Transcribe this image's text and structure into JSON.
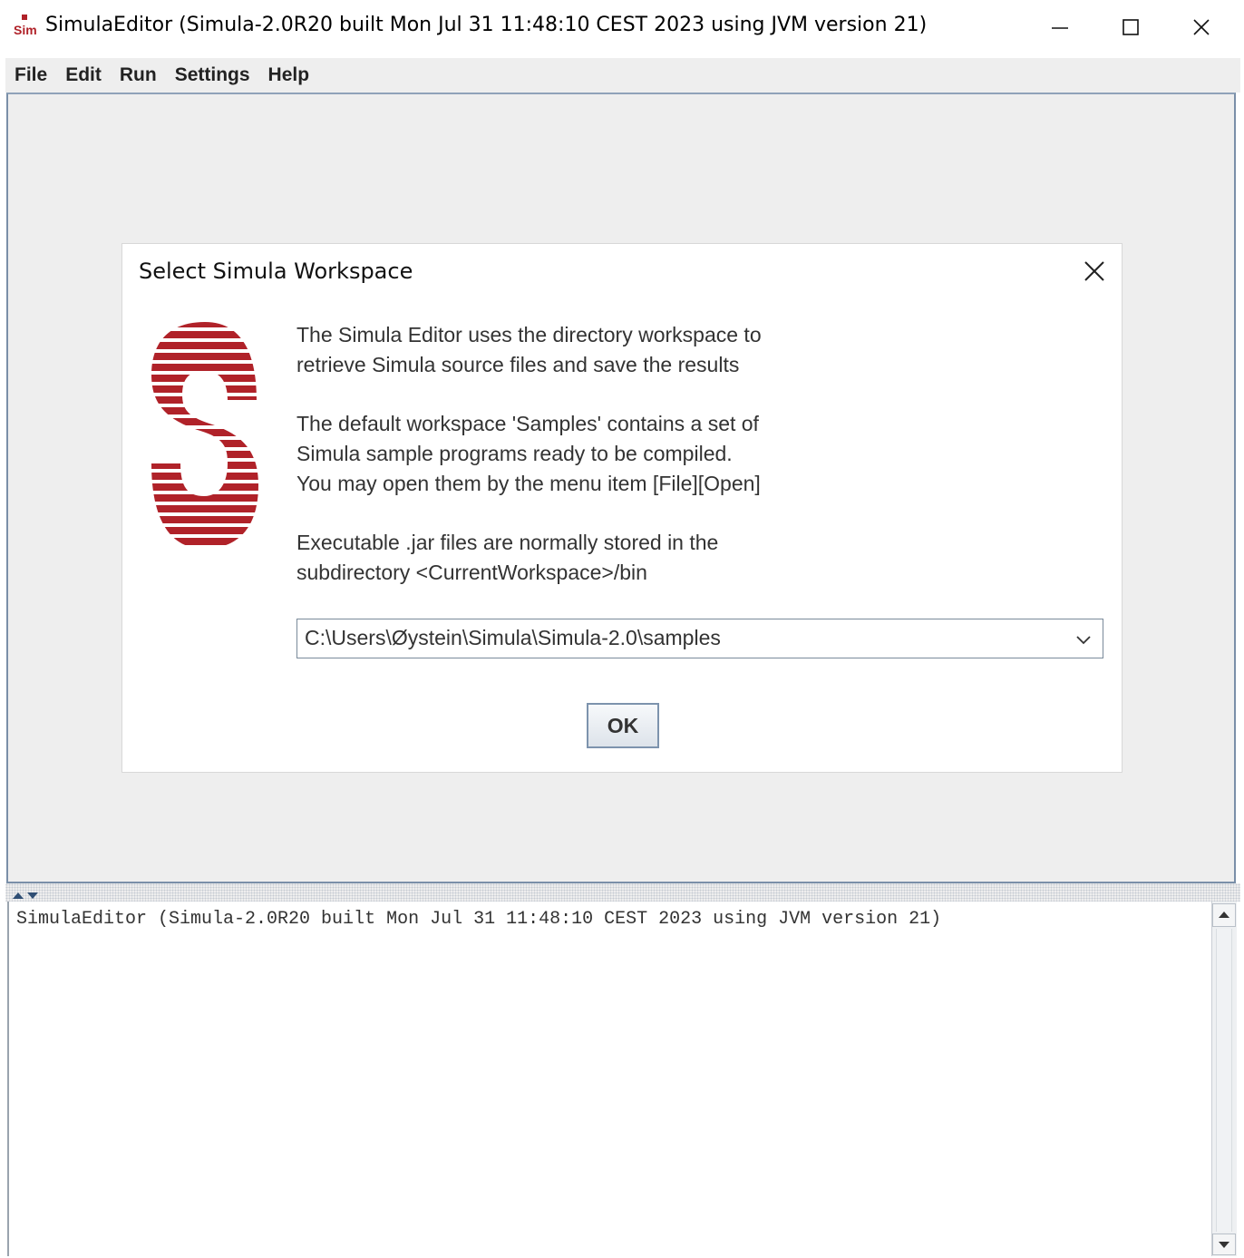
{
  "window": {
    "title": "SimulaEditor (Simula-2.0R20 built Mon Jul 31 11:48:10 CEST 2023 using JVM version 21)",
    "icons": [
      "app-icon",
      "minimize-icon",
      "maximize-icon",
      "close-icon"
    ]
  },
  "menu": {
    "items": [
      "File",
      "Edit",
      "Run",
      "Settings",
      "Help"
    ]
  },
  "dialog": {
    "title": "Select Simula Workspace",
    "logo_color": "#b02229",
    "paragraph1": [
      "The Simula Editor uses the directory workspace to",
      "retrieve Simula source files and save the results"
    ],
    "paragraph2": [
      "The default workspace 'Samples' contains a set of",
      "Simula sample programs ready to be compiled.",
      "You may open them by the menu item [File][Open]"
    ],
    "paragraph3": [
      "Executable .jar files are normally stored in the",
      "subdirectory <CurrentWorkspace>/bin"
    ],
    "workspace_path": "C:\\Users\\Øystein\\Simula\\Simula-2.0\\samples",
    "ok_label": "OK"
  },
  "console": {
    "text": "SimulaEditor (Simula-2.0R20 built Mon Jul 31 11:48:10 CEST 2023 using JVM version 21)"
  },
  "colors": {
    "accent_border": "#7d93ad",
    "logo_red": "#b02229"
  }
}
